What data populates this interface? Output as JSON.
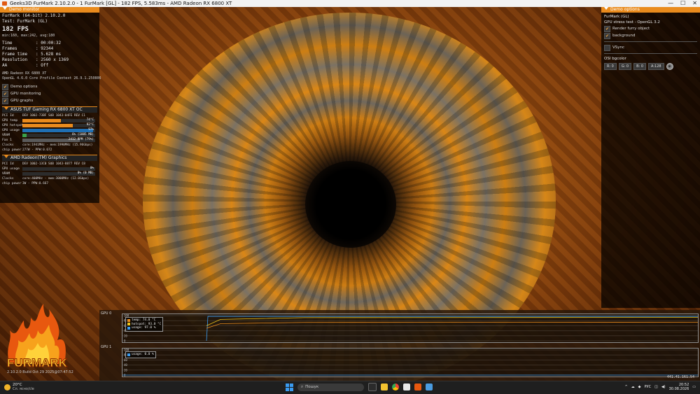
{
  "window": {
    "title": "Geeks3D FurMark 2.10.2.0 - 1 FurMark [GL] - 182 FPS, 5.583ms - AMD Radeon RX 6800 XT",
    "controls": [
      "—",
      "☐",
      "✕"
    ]
  },
  "demo_monitor": {
    "header": "Demo monitor",
    "app": "FurMark (64-bit) 2.10.2.0",
    "test": "Test: FurMark (GL)",
    "fps": "182 FPS",
    "fps_stats": "min:160, max:242, avg:180",
    "stats": [
      {
        "k": "Time",
        "v": ": 00:00:32"
      },
      {
        "k": "Frames",
        "v": ": 92344"
      },
      {
        "k": "Frame time",
        "v": ": 5.628 ms"
      },
      {
        "k": "Resolution",
        "v": ": 2560 x 1369"
      },
      {
        "k": "AA",
        "v": ": Off"
      }
    ],
    "renderer": "AMD Radeon RX 6800 XT",
    "gl_version": "OpenGL 4.6.0 Core Profile Context 26.9.1.250806",
    "checkboxes": [
      {
        "label": "Demo options",
        "checked": true
      },
      {
        "label": "GPU monitoring",
        "checked": true
      },
      {
        "label": "GPU graphs",
        "checked": true
      }
    ]
  },
  "gpu0": {
    "name": "ASUS TUF Gaming RX 6800 XT OC",
    "rows": [
      {
        "k": "PCI Id",
        "text": "DEV 1002-73BF SUB 1043-04FE REV C1"
      },
      {
        "k": "GPU temp",
        "bar": 0.53,
        "color": "#e98b1d",
        "v": "74°C"
      },
      {
        "k": "GPU hotspot",
        "bar": 0.69,
        "color": "#e98b1d",
        "v": "92°C"
      },
      {
        "k": "GPU usage",
        "bar": 0.97,
        "color": "#1f6fb3",
        "v": "97%"
      },
      {
        "k": "VRAM",
        "bar": 0.06,
        "color": "#3aa04a",
        "v": "6% (1005 MB)"
      },
      {
        "k": "Fan 1",
        "bar": 0.79,
        "color": "#5a5a5a",
        "v": "2412 RPM (79%)"
      },
      {
        "k": "Clocks",
        "text": "core:1941MHz - mem:1990MHz (15.96Gbps)"
      },
      {
        "k": "chip power",
        "text": "277W - PPW:0.672"
      }
    ]
  },
  "gpu1": {
    "name": "AMD Radeon(TM) Graphics",
    "rows": [
      {
        "k": "PCI Id",
        "text": "DEV 1002-13C0 SUB 1043-8877 REV C8"
      },
      {
        "k": "GPU usage",
        "bar": 0.0,
        "color": "#1f6fb3",
        "v": "0%"
      },
      {
        "k": "VRAM",
        "bar": 0.0,
        "color": "#3aa04a",
        "v": "0% (0 MB)"
      },
      {
        "k": "Clocks",
        "text": "core:400MHz - mem:3000MHz (12.0Gbps)"
      },
      {
        "k": "chip power",
        "text": "3W - PPW:0.667"
      }
    ]
  },
  "demo_options": {
    "header": "Demo options",
    "app": "FurMark (GL)",
    "subtitle": "GPU stress test - OpenGL 3.2",
    "checkboxes": [
      {
        "label": "Render furry object",
        "checked": true
      },
      {
        "label": "background",
        "checked": true
      }
    ],
    "vsync_label": "VSync",
    "vsync_checked": false,
    "bgcolor_label": "OSI bgcolor",
    "bgcolor": [
      "R: 0",
      "G: 0",
      "B: 0",
      "A:128"
    ]
  },
  "graphs": {
    "gpu0_label": "GPU 0",
    "gpu1_label": "GPU 1",
    "y_ticks": [
      "100",
      "80",
      "60",
      "40",
      "20",
      "0"
    ],
    "gpu0_legend": [
      {
        "label": "temp: 74.0 °C",
        "color": "#e98b1d"
      },
      {
        "label": "hotspot: 93.0 °C",
        "color": "#f0c419"
      },
      {
        "label": "usage: 97.0 %",
        "color": "#3a9bf0"
      }
    ],
    "gpu1_legend": [
      {
        "label": "usage: 0.0 %",
        "color": "#3a9bf0"
      }
    ],
    "fps_readout": "441.41.161.54"
  },
  "footer": {
    "logo_text": "FURMARK",
    "version": "2.10.2.0 Build Oct 29 2025@07:47:52"
  },
  "taskbar": {
    "temperature": "20°C",
    "weather": "Сл. ясно/сlе",
    "search_placeholder": "Пошук",
    "lang": "РУС",
    "time": "20:52",
    "date": "30.08.2026"
  }
}
